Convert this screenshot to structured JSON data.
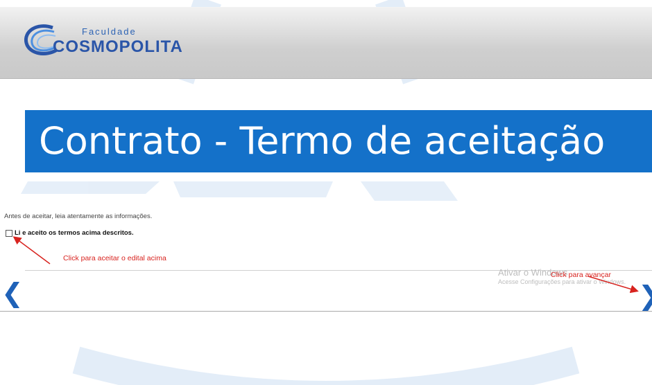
{
  "header": {
    "logo_small": "Faculdade",
    "logo_main": "COSMOPOLITA"
  },
  "page": {
    "title": "Contrato - Termo de aceitação",
    "notice": "Antes de aceitar, leia atentamente as informações.",
    "accept_label": "Li e aceito os termos acima descritos.",
    "accept_checked": false
  },
  "annotations": {
    "accept_hint": "Click para aceitar o edital acima",
    "next_hint": "Click para avançar"
  },
  "nav": {
    "prev_glyph": "❮",
    "next_glyph": "❯"
  },
  "windows_activation": {
    "title": "Ativar o Windows",
    "subtitle": "Acesse Configurações para ativar o Windows."
  },
  "colors": {
    "title_bar": "#1471c9",
    "brand_blue": "#2a55a8",
    "annotation_red": "#d8231f",
    "nav_blue": "#1f62b8"
  }
}
